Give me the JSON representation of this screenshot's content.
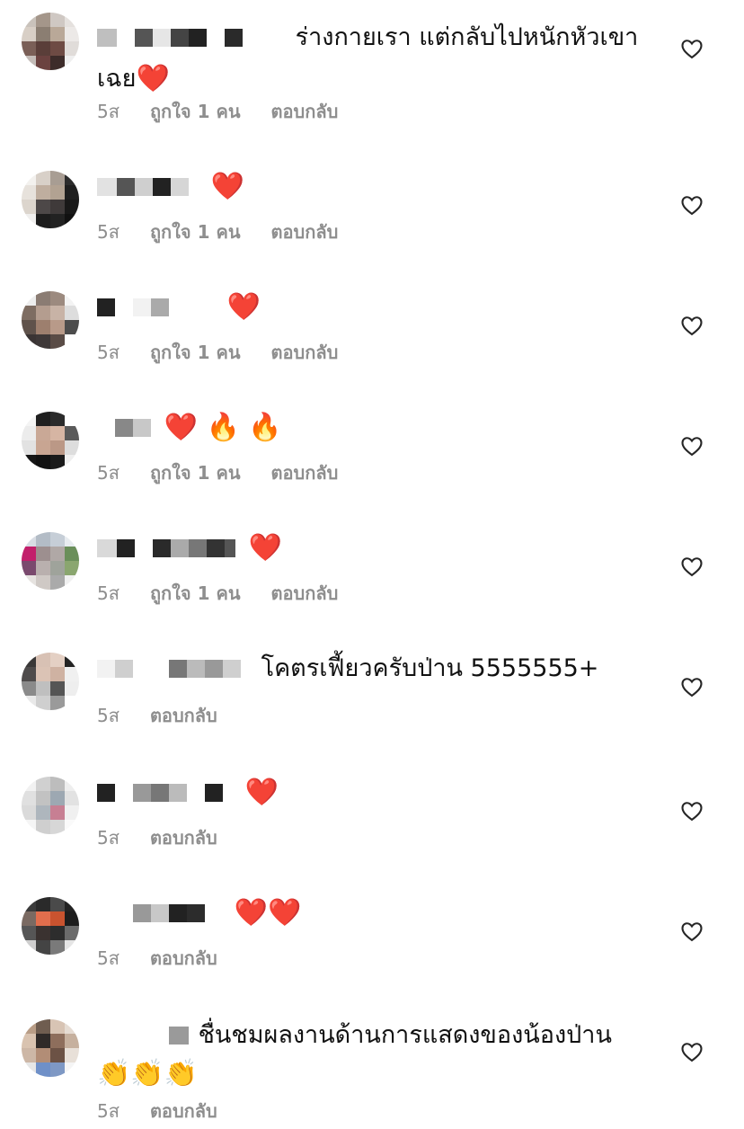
{
  "comments": [
    {
      "text": "ร่างกายเรา แต่กลับไปหนักหัวเขา",
      "text2": "เฉย",
      "emojis": "❤️",
      "time": "5ส",
      "likes": "ถูกใจ 1 คน",
      "reply": "ตอบกลับ"
    },
    {
      "text": "",
      "emojis": "❤️",
      "time": "5ส",
      "likes": "ถูกใจ 1 คน",
      "reply": "ตอบกลับ"
    },
    {
      "text": "",
      "emojis": "❤️",
      "time": "5ส",
      "likes": "ถูกใจ 1 คน",
      "reply": "ตอบกลับ"
    },
    {
      "text": "",
      "emojis": "❤️ 🔥 🔥",
      "time": "5ส",
      "likes": "ถูกใจ 1 คน",
      "reply": "ตอบกลับ"
    },
    {
      "text": "",
      "emojis": "❤️",
      "time": "5ส",
      "likes": "ถูกใจ 1 คน",
      "reply": "ตอบกลับ"
    },
    {
      "text": "โคตรเฟี้ยวครับป่าน 5555555+",
      "emojis": "",
      "time": "5ส",
      "reply": "ตอบกลับ"
    },
    {
      "text": "",
      "emojis": "❤️",
      "time": "5ส",
      "reply": "ตอบกลับ"
    },
    {
      "text": "",
      "emojis": "❤️❤️",
      "time": "5ส",
      "reply": "ตอบกลับ"
    },
    {
      "text": "ชื่นชมผลงานด้านการแสดงของน้องป่าน",
      "text2": "👏👏👏",
      "emojis": "",
      "time": "5ส",
      "reply": "ตอบกลับ"
    }
  ],
  "colors": {
    "meta": "#8e8e8e",
    "text": "#111111",
    "heart": "#e8243c"
  },
  "icons": {
    "like": "heart-outline-icon"
  }
}
